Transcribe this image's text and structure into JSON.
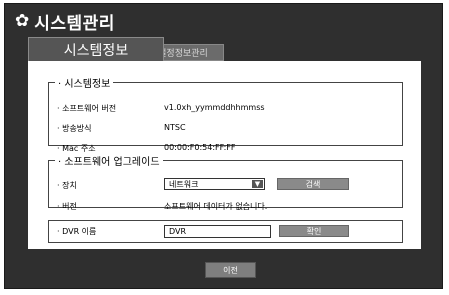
{
  "header": {
    "icon": "gear-icon",
    "title": "시스템관리"
  },
  "tabs": [
    {
      "label": "시스템정보",
      "active": true
    },
    {
      "label": "설정정보관리",
      "active": false
    }
  ],
  "system_info": {
    "legend": "· 시스템정보",
    "rows": [
      {
        "label": "· 소프트웨어 버전",
        "value": "v1.0xh_yymmddhhmmss"
      },
      {
        "label": "· 방송방식",
        "value": "NTSC"
      },
      {
        "label": "· Mac 주소",
        "value": "00:00:F0:54:FF:FF"
      }
    ]
  },
  "upgrade": {
    "legend": "· 소프트웨어 업그레이드",
    "device_label": "· 장치",
    "device_value": "네트워크",
    "search_label": "검색",
    "version_label": "· 버전",
    "version_value": "소프트웨어 데이터가 없습니다."
  },
  "dvr": {
    "label": "· DVR 이름",
    "value": "DVR",
    "confirm_label": "확인"
  },
  "footer": {
    "prev_label": "이전"
  }
}
